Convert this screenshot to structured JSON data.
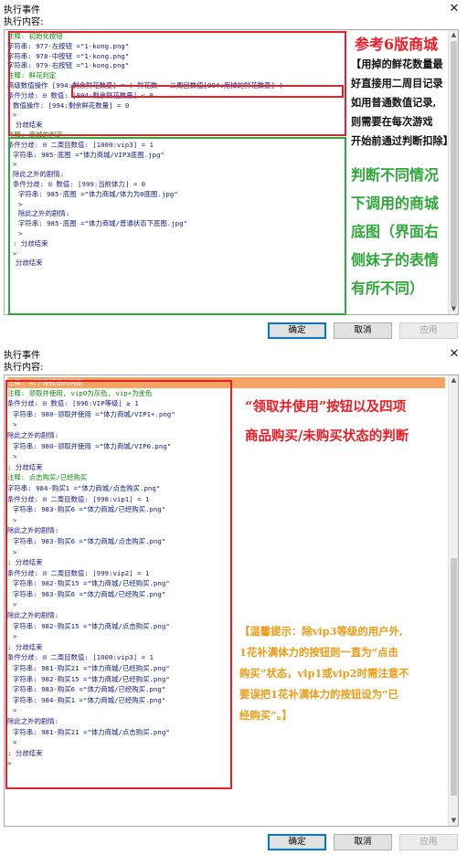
{
  "dialog1": {
    "title": "执行事件",
    "section_label": "执行内容:",
    "lines": [
      {
        "t": "注释: 初始化按钮",
        "k": "comment",
        "i": 0
      },
      {
        "t": "字符串: 977-左按钮 =\"1-kong.png\"",
        "k": "cmd",
        "i": 0
      },
      {
        "t": "字符串: 978-中按钮 =\"1-kong.png\"",
        "k": "cmd",
        "i": 0
      },
      {
        "t": "字符串: 979-右按钮 =\"1-kong.png\"",
        "k": "cmd",
        "i": 0
      },
      {
        "t": "注释: 鲜花判定",
        "k": "comment",
        "i": 0
      },
      {
        "t": "高级数值操作 [994:剩余鲜花数量] = ( 鲜花数 - 二周目数值[994:用掉的鲜花数量] )",
        "k": "cmd",
        "i": 0
      },
      {
        "t": "条件分歧: ⊟ 数值: [994:剩余鲜花数量] < 0",
        "k": "struct",
        "i": 0
      },
      {
        "t": "数值操作: [994:剩余鲜花数量] = 0",
        "k": "cmd",
        "i": 1
      },
      {
        "t": ">",
        "k": "struct",
        "i": 1
      },
      {
        "t": ": 分歧结束",
        "k": "struct",
        "i": 0
      },
      {
        "t": "注释: 商城的判定",
        "k": "comment",
        "i": 0
      },
      {
        "t": "条件分歧: ⊟ 二周目数值: [1000:vip3] = 1",
        "k": "struct",
        "i": 0
      },
      {
        "t": "字符串: 985-底图 =\"体力商城/VIP3底图.jpg\"",
        "k": "cmd",
        "i": 1
      },
      {
        "t": ">",
        "k": "struct",
        "i": 1
      },
      {
        "t": "除此之外的剧情:",
        "k": "struct",
        "i": 1
      },
      {
        "t": "条件分歧: ⊟ 数值: [999:当前体力] = 0",
        "k": "struct",
        "i": 1
      },
      {
        "t": "字符串: 985-底图 =\"体力商城/体力为0底图.jpg\"",
        "k": "cmd",
        "i": 2
      },
      {
        "t": ">",
        "k": "struct",
        "i": 2
      },
      {
        "t": "除此之外的剧情:",
        "k": "struct",
        "i": 2
      },
      {
        "t": "字符串: 985-底图 =\"体力商城/普通状态下底图.jpg\"",
        "k": "cmd",
        "i": 2
      },
      {
        "t": ">",
        "k": "struct",
        "i": 2
      },
      {
        "t": ": 分歧结束",
        "k": "struct",
        "i": 1
      },
      {
        "t": ">",
        "k": "struct",
        "i": 1
      },
      {
        "t": ": 分歧结束",
        "k": "struct",
        "i": 0
      }
    ],
    "note_red": "参考6版商城",
    "note_black": [
      "【用掉的鲜花数量最",
      "好直接用二周目记录",
      "如用普通数值记录,",
      "则需要在每次游戏",
      "开始前通过判断扣除】"
    ],
    "note_green": [
      "判断不同情况",
      "下调用的商城",
      "底图（界面右",
      "侧妹子的表情",
      "有所不同）"
    ],
    "buttons": {
      "ok": "确定",
      "cancel": "取消",
      "apply": "应用"
    }
  },
  "dialog2": {
    "title": "执行事件",
    "section_label": "执行内容:",
    "lines": [
      {
        "t": "注释: 以下是按钮的判定",
        "k": "sel",
        "i": 0
      },
      {
        "t": "注释: 领取并使用, vip0为灰色, vip+为金色",
        "k": "comment",
        "i": 0
      },
      {
        "t": "条件分歧: ⊟ 数值: [996:VIP等级] ≥ 1",
        "k": "struct",
        "i": 0
      },
      {
        "t": "字符串: 980-领取并使用 =\"体力商城/VIP1+.png\"",
        "k": "cmd",
        "i": 1
      },
      {
        "t": ">",
        "k": "struct",
        "i": 1
      },
      {
        "t": "除此之外的剧情:",
        "k": "struct",
        "i": 0
      },
      {
        "t": "字符串: 980-领取并使用 =\"体力商城/VIP0.png\"",
        "k": "cmd",
        "i": 1
      },
      {
        "t": ">",
        "k": "struct",
        "i": 1
      },
      {
        "t": ": 分歧结束",
        "k": "struct",
        "i": 0
      },
      {
        "t": "注释: 点击购买/已经购买",
        "k": "comment",
        "i": 0
      },
      {
        "t": "字符串: 984-购买1 =\"体力商城/点击购买.png\"",
        "k": "cmd",
        "i": 0
      },
      {
        "t": "条件分歧: ⊟ 二周目数值: [998:vip1] = 1",
        "k": "struct",
        "i": 0
      },
      {
        "t": "字符串: 983-购买6 =\"体力商城/已经购买.png\"",
        "k": "cmd",
        "i": 1
      },
      {
        "t": ">",
        "k": "struct",
        "i": 1
      },
      {
        "t": "除此之外的剧情:",
        "k": "struct",
        "i": 0
      },
      {
        "t": "字符串: 983-购买6 =\"体力商城/点击购买.png\"",
        "k": "cmd",
        "i": 1
      },
      {
        "t": ">",
        "k": "struct",
        "i": 1
      },
      {
        "t": ": 分歧结束",
        "k": "struct",
        "i": 0
      },
      {
        "t": "条件分歧: ⊟ 二周目数值: [999:vip2] = 1",
        "k": "struct",
        "i": 0
      },
      {
        "t": "字符串: 982-购买15 =\"体力商城/已经购买.png\"",
        "k": "cmd",
        "i": 1
      },
      {
        "t": "字符串: 983-购买6 =\"体力商城/已经购买.png\"",
        "k": "cmd",
        "i": 1
      },
      {
        "t": ">",
        "k": "struct",
        "i": 1
      },
      {
        "t": "除此之外的剧情:",
        "k": "struct",
        "i": 0
      },
      {
        "t": "字符串: 982-购买15 =\"体力商城/点击购买.png\"",
        "k": "cmd",
        "i": 1
      },
      {
        "t": ">",
        "k": "struct",
        "i": 1
      },
      {
        "t": ": 分歧结束",
        "k": "struct",
        "i": 0
      },
      {
        "t": "条件分歧: ⊟ 二周目数值: [1000:vip3] = 1",
        "k": "struct",
        "i": 0
      },
      {
        "t": "字符串: 981-购买21 =\"体力商城/已经购买.png\"",
        "k": "cmd",
        "i": 1
      },
      {
        "t": "字符串: 982-购买15 =\"体力商城/已经购买.png\"",
        "k": "cmd",
        "i": 1
      },
      {
        "t": "字符串: 983-购买6 =\"体力商城/已经购买.png\"",
        "k": "cmd",
        "i": 1
      },
      {
        "t": "字符串: 984-购买1 =\"体力商城/已经购买.png\"",
        "k": "cmd",
        "i": 1
      },
      {
        "t": ">",
        "k": "struct",
        "i": 1
      },
      {
        "t": "除此之外的剧情:",
        "k": "struct",
        "i": 0
      },
      {
        "t": "字符串: 981-购买21 =\"体力商城/点击购买.png\"",
        "k": "cmd",
        "i": 1
      },
      {
        "t": ">",
        "k": "struct",
        "i": 1
      },
      {
        "t": ": 分歧结束",
        "k": "struct",
        "i": 0
      },
      {
        "t": ">",
        "k": "struct",
        "i": 0
      }
    ],
    "note_red": [
      "“领取并使用”按钮以及四项",
      "商品购买/未购买状态的判断"
    ],
    "note_orange": [
      "【温馨提示：除vip3等级的用户外,",
      "1花补满体力的按钮则一直为“点击",
      "购买”状态，vip1或vip2时需注意不",
      "要误把1花补满体力的按钮设为“已",
      "经购买”。】"
    ],
    "buttons": {
      "ok": "确定",
      "cancel": "取消",
      "apply": "应用"
    }
  },
  "colors": {
    "highlight_red": "#e8202a",
    "highlight_green": "#2faa3a",
    "selection": "#f4a460",
    "note_orange": "#f09a14",
    "comment_green": "#0a8a0a"
  }
}
